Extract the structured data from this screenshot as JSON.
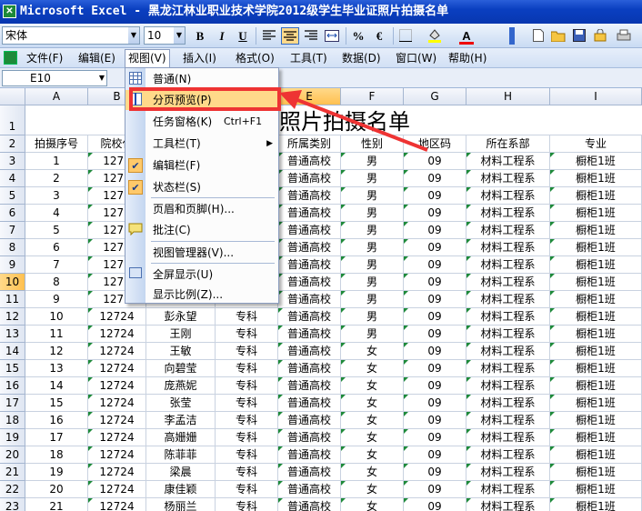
{
  "window": {
    "title": "Microsoft Excel - 黑龙江林业职业技术学院2012级学生毕业证照片拍摄名单",
    "icon": "excel-icon"
  },
  "toolbar": {
    "font": "宋体",
    "size": "10",
    "bold": "B",
    "italic": "I",
    "underline": "U",
    "percent": "%",
    "euro": "€",
    "font_color": "A",
    "icons": [
      "align-left-icon",
      "align-center-icon",
      "align-right-icon",
      "merge-center-icon",
      "borders-icon",
      "fill-color-icon",
      "new-icon",
      "open-icon",
      "save-icon",
      "permission-icon"
    ]
  },
  "menubar": {
    "items": [
      "文件(F)",
      "编辑(E)",
      "视图(V)",
      "插入(I)",
      "格式(O)",
      "工具(T)",
      "数据(D)",
      "窗口(W)",
      "帮助(H)"
    ],
    "open_index": 2
  },
  "namebox": "E10",
  "columns": [
    "A",
    "B",
    "C",
    "D",
    "E",
    "F",
    "G",
    "H",
    "I"
  ],
  "active_col": "E",
  "active_row": "10",
  "row_numbers": [
    "1",
    "2",
    "3",
    "4",
    "5",
    "6",
    "7",
    "8",
    "9",
    "10",
    "11",
    "12",
    "13",
    "14",
    "15",
    "16",
    "17",
    "18",
    "19",
    "20",
    "21",
    "22",
    "23"
  ],
  "sheet_title": "证照片拍摄名单",
  "headers": [
    "拍摄序号",
    "院校代",
    "",
    "",
    "所属类别",
    "性别",
    "地区码",
    "所在系部",
    "专业"
  ],
  "rows": [
    [
      "1",
      "1272",
      "",
      "",
      "普通高校",
      "男",
      "09",
      "材料工程系",
      "橱柜1班"
    ],
    [
      "2",
      "1272",
      "",
      "",
      "普通高校",
      "男",
      "09",
      "材料工程系",
      "橱柜1班"
    ],
    [
      "3",
      "1272",
      "",
      "",
      "普通高校",
      "男",
      "09",
      "材料工程系",
      "橱柜1班"
    ],
    [
      "4",
      "1272",
      "",
      "",
      "普通高校",
      "男",
      "09",
      "材料工程系",
      "橱柜1班"
    ],
    [
      "5",
      "1272",
      "",
      "",
      "普通高校",
      "男",
      "09",
      "材料工程系",
      "橱柜1班"
    ],
    [
      "6",
      "1272",
      "",
      "",
      "普通高校",
      "男",
      "09",
      "材料工程系",
      "橱柜1班"
    ],
    [
      "7",
      "1272",
      "",
      "",
      "普通高校",
      "男",
      "09",
      "材料工程系",
      "橱柜1班"
    ],
    [
      "8",
      "1272",
      "",
      "",
      "普通高校",
      "男",
      "09",
      "材料工程系",
      "橱柜1班"
    ],
    [
      "9",
      "1272",
      "",
      "",
      "普通高校",
      "男",
      "09",
      "材料工程系",
      "橱柜1班"
    ],
    [
      "10",
      "12724",
      "彭永望",
      "专科",
      "普通高校",
      "男",
      "09",
      "材料工程系",
      "橱柜1班"
    ],
    [
      "11",
      "12724",
      "王刚",
      "专科",
      "普通高校",
      "男",
      "09",
      "材料工程系",
      "橱柜1班"
    ],
    [
      "12",
      "12724",
      "王敏",
      "专科",
      "普通高校",
      "女",
      "09",
      "材料工程系",
      "橱柜1班"
    ],
    [
      "13",
      "12724",
      "向碧莹",
      "专科",
      "普通高校",
      "女",
      "09",
      "材料工程系",
      "橱柜1班"
    ],
    [
      "14",
      "12724",
      "庞燕妮",
      "专科",
      "普通高校",
      "女",
      "09",
      "材料工程系",
      "橱柜1班"
    ],
    [
      "15",
      "12724",
      "张莹",
      "专科",
      "普通高校",
      "女",
      "09",
      "材料工程系",
      "橱柜1班"
    ],
    [
      "16",
      "12724",
      "李孟洁",
      "专科",
      "普通高校",
      "女",
      "09",
      "材料工程系",
      "橱柜1班"
    ],
    [
      "17",
      "12724",
      "高姗姗",
      "专科",
      "普通高校",
      "女",
      "09",
      "材料工程系",
      "橱柜1班"
    ],
    [
      "18",
      "12724",
      "陈菲菲",
      "专科",
      "普通高校",
      "女",
      "09",
      "材料工程系",
      "橱柜1班"
    ],
    [
      "19",
      "12724",
      "梁晨",
      "专科",
      "普通高校",
      "女",
      "09",
      "材料工程系",
      "橱柜1班"
    ],
    [
      "20",
      "12724",
      "康佳颖",
      "专科",
      "普通高校",
      "女",
      "09",
      "材料工程系",
      "橱柜1班"
    ],
    [
      "21",
      "12724",
      "杨丽兰",
      "专科",
      "普通高校",
      "女",
      "09",
      "材料工程系",
      "橱柜1班"
    ]
  ],
  "view_menu": [
    {
      "label": "普通(N)",
      "icon": "normal-view-icon",
      "checked": false
    },
    {
      "label": "分页预览(P)",
      "icon": "page-break-preview-icon",
      "checked": false,
      "highlighted": true
    },
    {
      "label": "任务窗格(K)",
      "shortcut": "Ctrl+F1",
      "checked": false
    },
    {
      "label": "工具栏(T)",
      "submenu": true,
      "checked": false
    },
    {
      "label": "编辑栏(F)",
      "checked": true
    },
    {
      "label": "状态栏(S)",
      "checked": true
    },
    {
      "label": "页眉和页脚(H)...",
      "checked": false
    },
    {
      "label": "批注(C)",
      "icon": "comment-icon",
      "checked": false
    },
    {
      "label": "视图管理器(V)...",
      "checked": false
    },
    {
      "label": "全屏显示(U)",
      "icon": "full-screen-icon",
      "checked": false
    },
    {
      "label": "显示比例(Z)...",
      "checked": false
    }
  ],
  "colors": {
    "title_bar": "#0a3fc0",
    "menu_highlight": "#ffd98a",
    "annotation": "#e33333",
    "comment_marker": "#1e8a3a"
  }
}
